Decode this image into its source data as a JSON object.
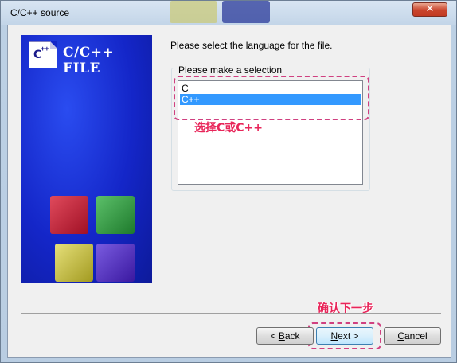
{
  "window": {
    "title": "C/C++ source",
    "close_glyph": "✕"
  },
  "banner": {
    "title": "C/C++ FILE",
    "icon": "cpp-file-icon",
    "icon_text_main": "C",
    "icon_text_sup": "++"
  },
  "content": {
    "prompt": "Please select the language for the file.",
    "group_label": "Please make a selection",
    "options": [
      {
        "label": "C",
        "selected": false
      },
      {
        "label": "C++",
        "selected": true
      }
    ]
  },
  "annotations": {
    "select_hint": "选择C或C++",
    "confirm_hint": "确认下一步"
  },
  "buttons": {
    "back": {
      "access_key": "B",
      "label_prefix": "< ",
      "label_suffix": "ack"
    },
    "next": {
      "access_key": "N",
      "label_suffix": "ext >"
    },
    "cancel": {
      "access_key": "C",
      "label_suffix": "ancel"
    }
  },
  "colors": {
    "selection": "#3399ff",
    "annotation": "#e8265a",
    "banner_blue": "#1426c8"
  }
}
